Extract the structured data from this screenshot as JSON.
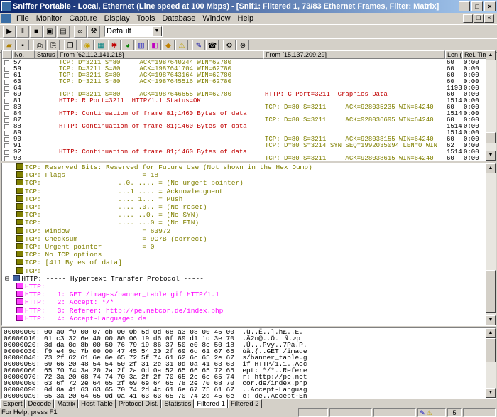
{
  "window": {
    "title": "Sniffer Portable - Local, Ethernet (Line speed at 100 Mbps) - [Snif1: Filtered 1, 73/83 Ethernet Frames, Filter: Matrix]"
  },
  "menu": [
    "File",
    "Monitor",
    "Capture",
    "Display",
    "Tools",
    "Database",
    "Window",
    "Help"
  ],
  "toolbar": {
    "profile": "Default"
  },
  "summary": {
    "headers": [
      "No.",
      "Status",
      "From [62.112.141.218]",
      "From [15.137.209.29]",
      "Len (B",
      "Rel. Time"
    ],
    "rows": [
      {
        "no": "57",
        "left": "TCP: D=3211 S=80     ACK=1987640244 WIN=62780",
        "lc": "olive",
        "right": "",
        "len": "60",
        "time": "0:00"
      },
      {
        "no": "59",
        "left": "TCP: D=3211 S=80     ACK=1987641704 WIN=62780",
        "lc": "olive",
        "right": "",
        "len": "60",
        "time": "0:00"
      },
      {
        "no": "61",
        "left": "TCP: D=3211 S=80     ACK=1987643164 WIN=62780",
        "lc": "olive",
        "right": "",
        "len": "60",
        "time": "0:00"
      },
      {
        "no": "63",
        "left": "TCP: D=3211 S=80     ACK=1987645516 WIN=62780",
        "lc": "olive",
        "right": "",
        "len": "60",
        "time": "0:00"
      },
      {
        "no": "64",
        "left": "",
        "lc": "olive",
        "right": "",
        "len": "1193",
        "time": "0:00"
      },
      {
        "no": "69",
        "left": "TCP: D=3211 S=80     ACK=1987646655 WIN=62780",
        "lc": "olive",
        "right": "HTTP: C Port=3211  Graphics Data",
        "rc": "red",
        "len": "60",
        "time": "0:00"
      },
      {
        "no": "81",
        "left": "HTTP: R Port=3211  HTTP/1.1 Status=OK",
        "lc": "red",
        "right": "",
        "len": "1514",
        "time": "0:00"
      },
      {
        "no": "83",
        "left": "",
        "lc": "olive",
        "right": "TCP: D=80 S=3211     ACK=928035235 WIN=64240",
        "rc": "olive",
        "len": "60",
        "time": "0:00"
      },
      {
        "no": "84",
        "left": "HTTP: Continuation of frame 81;1460 Bytes of data",
        "lc": "red",
        "right": "",
        "len": "1514",
        "time": "0:00"
      },
      {
        "no": "87",
        "left": "",
        "lc": "olive",
        "right": "TCP: D=80 S=3211     ACK=928036695 WIN=64240",
        "rc": "olive",
        "len": "60",
        "time": "0:00"
      },
      {
        "no": "88",
        "left": "HTTP: Continuation of frame 81;1460 Bytes of data",
        "lc": "red",
        "right": "",
        "len": "1514",
        "time": "0:00"
      },
      {
        "no": "89",
        "left": "",
        "lc": "olive",
        "right": "",
        "len": "1514",
        "time": "0:00"
      },
      {
        "no": "90",
        "left": "",
        "lc": "olive",
        "right": "TCP: D=80 S=3211     ACK=928038155 WIN=64240",
        "rc": "olive",
        "len": "60",
        "time": "0:00"
      },
      {
        "no": "91",
        "left": "",
        "lc": "olive",
        "right": "TCP: D=80 S=3214 SYN SEQ=1992035094 LEN=0 WIN",
        "rc": "olive",
        "len": "62",
        "time": "0:00"
      },
      {
        "no": "92",
        "left": "HTTP: Continuation of frame 81;1460 Bytes of data",
        "lc": "red",
        "right": "",
        "len": "1514",
        "time": "0:00"
      },
      {
        "no": "93",
        "left": "",
        "lc": "olive",
        "right": "TCP: D=80 S=3211     ACK=928038615 WIN=64240",
        "rc": "olive",
        "len": "60",
        "time": "0:00"
      }
    ]
  },
  "decode": [
    {
      "t": "TCP: Reserved Bits: Reserved for Future Use (Not shown in the Hex Dump)",
      "c": "olive",
      "i": "olive"
    },
    {
      "t": "TCP: Flags                   = 18",
      "c": "olive",
      "i": "olive"
    },
    {
      "t": "TCP:                   ..0. .... = (No urgent pointer)",
      "c": "olive",
      "i": "olive"
    },
    {
      "t": "TCP:                   ...1 .... = Acknowledgment",
      "c": "olive",
      "i": "olive"
    },
    {
      "t": "TCP:                   .... 1... = Push",
      "c": "olive",
      "i": "olive"
    },
    {
      "t": "TCP:                   .... .0.. = (No reset)",
      "c": "olive",
      "i": "olive"
    },
    {
      "t": "TCP:                   .... ..0. = (No SYN)",
      "c": "olive",
      "i": "olive"
    },
    {
      "t": "TCP:                   .... ...0 = (No FIN)",
      "c": "olive",
      "i": "olive"
    },
    {
      "t": "TCP: Window                  = 63972",
      "c": "olive",
      "i": "olive"
    },
    {
      "t": "TCP: Checksum                = 9C7B (correct)",
      "c": "olive",
      "i": "olive"
    },
    {
      "t": "TCP: Urgent pointer          = 0",
      "c": "olive",
      "i": "olive"
    },
    {
      "t": "TCP: No TCP options",
      "c": "olive",
      "i": "olive"
    },
    {
      "t": "TCP: [411 Bytes of data]",
      "c": "olive",
      "i": "olive"
    },
    {
      "t": "TCP:",
      "c": "olive",
      "i": "olive"
    },
    {
      "t": "HTTP: ----- Hypertext Transfer Protocol -----",
      "c": "black",
      "i": "root"
    },
    {
      "t": "HTTP:",
      "c": "pink",
      "i": "pink"
    },
    {
      "t": "HTTP:   1: GET /images/banner_table gif HTTP/1.1",
      "c": "pink",
      "i": "pink"
    },
    {
      "t": "HTTP:   2: Accept: */*",
      "c": "pink",
      "i": "pink"
    },
    {
      "t": "HTTP:   3: Referer: http://pe.netcor.de/index.php",
      "c": "pink",
      "i": "pink"
    },
    {
      "t": "HTTP:   4: Accept-Language: de",
      "c": "pink",
      "i": "pink"
    }
  ],
  "hex": [
    "00000000: 00 a0 f9 00 07 cb 00 0b 5d 0d 68 a3 08 00 45 00  .ù..Ë..].h£..E.",
    "00000010: 01 c3 32 6e 40 00 80 06 19 d6 0f 89 d1 1d 3e 70  .Ã2n@..Ö.Ñ.>p",
    "00000020: 8d da 0c 8b 00 50 76 79 19 86 37 50 e0 8e 50 18  .Ú...Pvy..7Pà.P.",
    "00000030: f9 e4 9c 7b 00 00 47 45 54 20 2f 69 6d 61 67 65  ùä.{..GET /image",
    "00000040: 73 2f 62 61 6e 6e 65 72 5f 74 61 62 6c 65 2e 67  s/banner_table.g",
    "00000050: 69 66 20 48 54 54 50 2f 31 2e 31 0d 0a 41 63 63  if HTTP/1.1..Acc",
    "00000060: 65 70 74 3a 20 2a 2f 2a 0d 0a 52 65 66 65 72 65  ept: */*..Refere",
    "00000070: 72 3a 20 68 74 74 70 3a 2f 2f 70 65 2e 6e 65 74  r: http://pe.net",
    "00000080: 63 6f 72 2e 64 65 2f 69 6e 64 65 78 2e 70 68 70  cor.de/index.php",
    "00000090: 0d 0a 41 63 63 65 70 74 2d 4c 61 6e 67 75 61 67  ..Accept-Languag",
    "000000a0: 65 3a 20 64 65 0d 0a 41 63 63 65 70 74 2d 45 6e  e: de..Accept-En"
  ],
  "tabs": [
    "Expert",
    "Decode",
    "Matrix",
    "Host Table",
    "Protocol Dist.",
    "Statistics",
    "Filtered 1",
    "Filtered 2"
  ],
  "active_tab": "Filtered 1",
  "status": {
    "help": "For Help, press F1",
    "count": "5"
  }
}
